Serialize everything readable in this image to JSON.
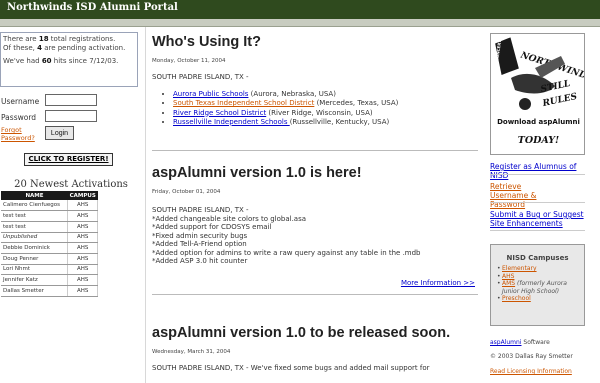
{
  "header": {
    "title": "Northwinds ISD Alumni Portal"
  },
  "stats": {
    "line1_pre": "There are ",
    "registrations": "18",
    "line1_post": " total registrations.",
    "line2_pre": "Of these, ",
    "pending": "4",
    "line2_post": " are pending activation.",
    "line3_pre": "We've had ",
    "hits": "60",
    "line3_post": " hits since 7/12/03."
  },
  "login": {
    "username_label": "Username",
    "password_label": "Password",
    "forgot_line1": "Forgot",
    "forgot_line2": "Password?",
    "login_button": "Login"
  },
  "register_button": "CLICK TO REGISTER!",
  "activations": {
    "title": "20 Newest Activations",
    "columns": [
      "NAME",
      "CAMPUS"
    ],
    "rows": [
      [
        "Calimero Cienfuegos",
        "AHS"
      ],
      [
        "test test",
        "AHS"
      ],
      [
        "test test",
        "AHS"
      ],
      [
        "Unpublished",
        "AHS"
      ],
      [
        "Debbie Dominick",
        "AHS"
      ],
      [
        "Doug Penner",
        "AHS"
      ],
      [
        "Lori Nhmt",
        "AHS"
      ],
      [
        "Jennifer Katz",
        "AHS"
      ],
      [
        "Dallas Smetter",
        "AHS"
      ]
    ]
  },
  "posts": [
    {
      "title": "Who's Using It?",
      "date": "Monday, October 11, 2004",
      "location": "SOUTH PADRE ISLAND, TX -",
      "items": [
        {
          "link": "Aurora Public Schools",
          "rest": " (Aurora, Nebraska, USA)",
          "orange": false
        },
        {
          "link": "South Texas Independent School District",
          "rest": " (Mercedes, Texas, USA)",
          "orange": true
        },
        {
          "link": "River Ridge School District",
          "rest": " (River Ridge, Wisconsin, USA)",
          "orange": false
        },
        {
          "link": "Russellville Independent Schools ",
          "rest": "(Russellville, Kentucky, USA)",
          "orange": false
        }
      ]
    },
    {
      "title": "aspAlumni version 1.0 is here!",
      "date": "Friday, October 01, 2004",
      "location": "SOUTH PADRE ISLAND, TX -",
      "lines": [
        "*Added changeable site colors to global.asa",
        "*Added support for CDOSYS email",
        "*Fixed admin security bugs",
        "*Added Tell-A-Friend option",
        "*Added option for admins to write a raw query against any table in the .mdb",
        "*Added ASP 3.0 hit counter"
      ],
      "more": "More Information >>"
    },
    {
      "title": "aspAlumni version 1.0 to be released soon.",
      "date": "Wednesday, March 31, 2004",
      "body": "SOUTH PADRE ISLAND, TX - We've fixed some bugs and added mail support for"
    }
  ],
  "ad": {
    "badge_lines": [
      "IN",
      "CONCERT",
      "FROM",
      "TRIUMPH"
    ],
    "logo_text": "NORTHWINDS",
    "logo_text2": "STILL",
    "logo_text3": "RULES",
    "download": "Download aspAlumni",
    "today": "TODAY!"
  },
  "sidelinks": {
    "register": "Register as Alumnus of NISD",
    "retrieve": "Retrieve Username & Password",
    "submit": "Submit a Bug or Suggest Site Enhancements"
  },
  "campuses": {
    "title": "NISD Campuses",
    "items": [
      {
        "name": "Elementary",
        "note": ""
      },
      {
        "name": "AHS",
        "note": ""
      },
      {
        "name": "AMS",
        "note": " (formerly Aurora Junior High School)"
      },
      {
        "name": "Preschool",
        "note": ""
      }
    ]
  },
  "footer": {
    "brand": "aspAlumni",
    "brand_suffix": " Software",
    "copyright": "© 2003 Dallas Ray Smetter",
    "license": "Read Licensing Information"
  },
  "colors": {
    "topbar": "#2f4a1e",
    "link": "#0000cc",
    "accent_orange": "#cc5500"
  }
}
